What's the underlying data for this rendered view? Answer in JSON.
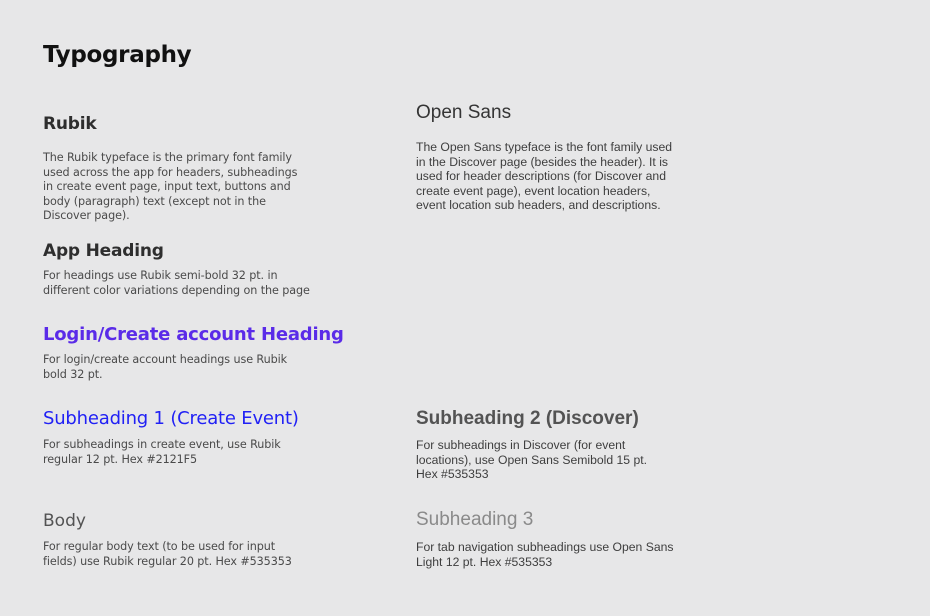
{
  "page": {
    "title": "Typography"
  },
  "colors": {
    "login_heading": "#5a2be8",
    "subheading_create_event": "#2121F5",
    "body_text": "#535353",
    "subheading_3": "#8a8a8a"
  },
  "rubik": {
    "heading": "Rubik",
    "lines": [
      "The Rubik typeface is the primary font family",
      "used across the app for headers, subheadings",
      "in create event page, input text, buttons and",
      "body (paragraph) text (except not in the",
      "Discover page)."
    ]
  },
  "open_sans": {
    "heading": "Open Sans",
    "lines": [
      "The Open Sans typeface is the font family used",
      "in the Discover page (besides the header). It is",
      "used for header descriptions (for Discover and",
      "create event page), event location headers,",
      "event location sub headers, and descriptions."
    ]
  },
  "app_heading": {
    "heading": "App Heading",
    "lines": [
      "For headings use Rubik semi-bold 32 pt. in",
      "different color variations depending on the page"
    ]
  },
  "login_heading": {
    "heading": "Login/Create account Heading",
    "lines": [
      "For login/create account headings use Rubik",
      "bold 32 pt."
    ]
  },
  "subheading_1": {
    "heading": "Subheading 1 (Create Event)",
    "lines": [
      "For subheadings in create event, use Rubik",
      "regular 12 pt. Hex #2121F5"
    ]
  },
  "subheading_2": {
    "heading": "Subheading 2 (Discover)",
    "lines": [
      "For subheadings in Discover (for event",
      "locations), use Open Sans Semibold 15 pt.",
      "Hex #535353"
    ]
  },
  "body": {
    "heading": "Body",
    "lines": [
      "For regular body text (to be used for input",
      "fields) use Rubik regular 20 pt. Hex #535353"
    ]
  },
  "subheading_3": {
    "heading": "Subheading 3",
    "lines": [
      "For tab navigation subheadings use Open Sans",
      "Light 12 pt. Hex #535353"
    ]
  }
}
